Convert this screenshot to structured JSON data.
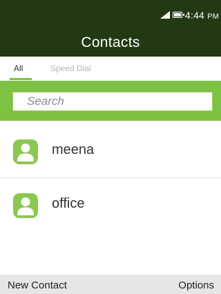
{
  "status": {
    "time": "4:44",
    "ampm": "PM"
  },
  "header": {
    "title": "Contacts"
  },
  "tabs": [
    {
      "label": "All",
      "active": true
    },
    {
      "label": "Speed Dial",
      "active": false
    }
  ],
  "search": {
    "placeholder": "Search",
    "value": ""
  },
  "contacts": [
    {
      "name": "meena",
      "icon": "person-avatar-icon"
    },
    {
      "name": "office",
      "icon": "person-avatar-icon"
    }
  ],
  "softkeys": {
    "left": "New Contact",
    "right": "Options"
  },
  "colors": {
    "header_bg": "#223a14",
    "accent": "#7dc242",
    "avatar": "#8cc751",
    "softkey_bg": "#e6e6e6"
  }
}
